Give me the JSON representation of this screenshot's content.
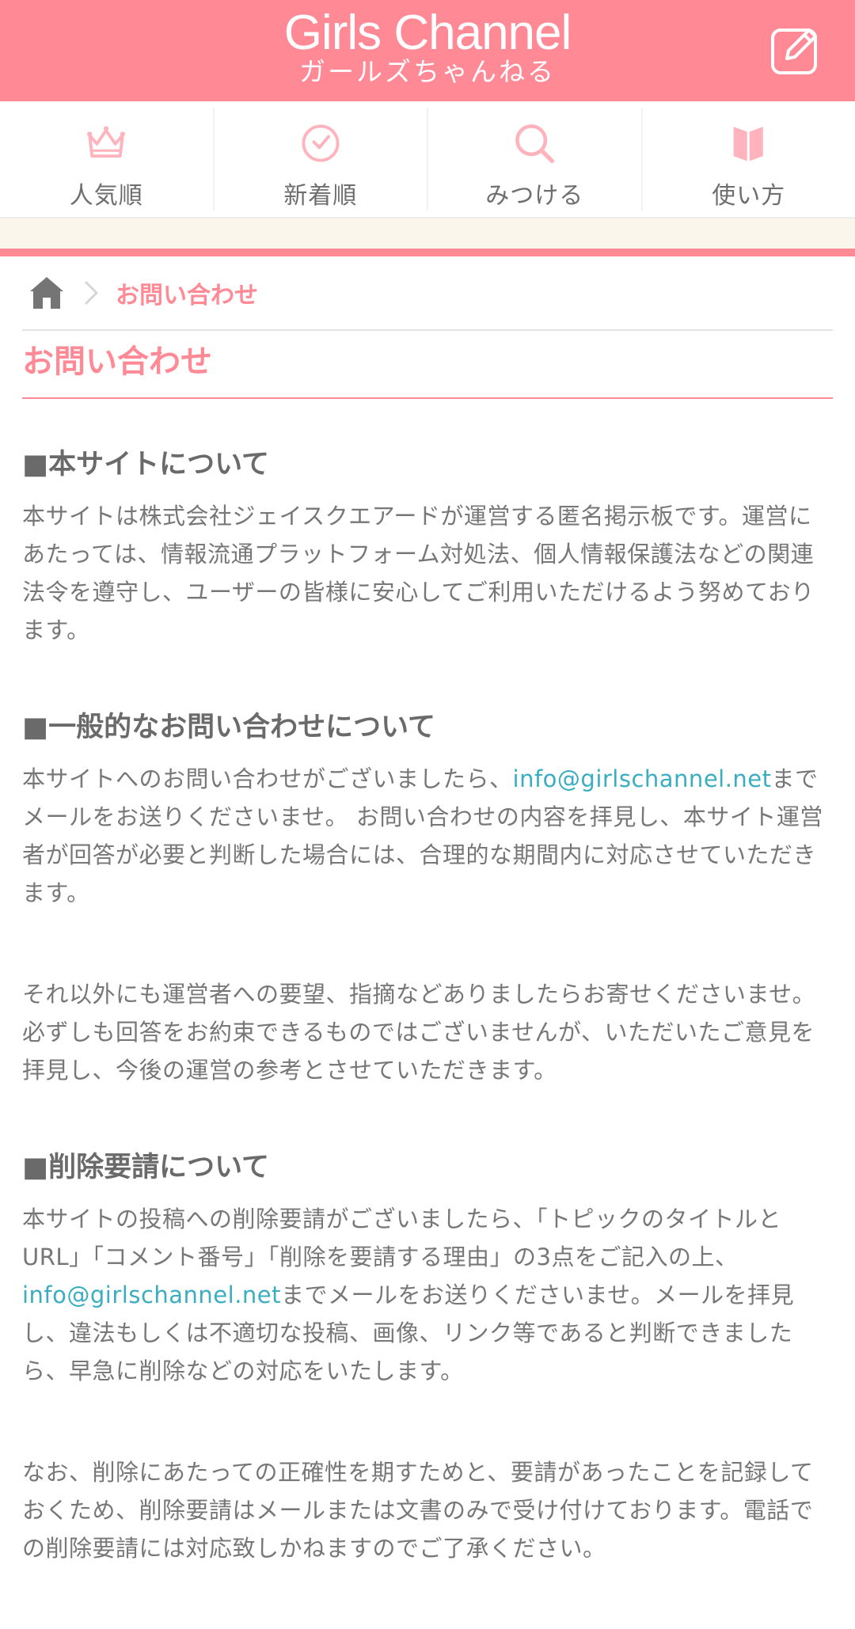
{
  "header": {
    "logo_en": "Girls Channel",
    "logo_ja": "ガールズちゃんねる",
    "bg_color": "#ff8a96",
    "post_icon": "edit-icon"
  },
  "nav": {
    "items": [
      {
        "label": "人気順",
        "icon": "crown-icon"
      },
      {
        "label": "新着順",
        "icon": "clock-icon"
      },
      {
        "label": "みつける",
        "icon": "search-icon"
      },
      {
        "label": "使い方",
        "icon": "book-icon"
      }
    ]
  },
  "breadcrumb": {
    "home_icon": "home-icon",
    "current": "お問い合わせ"
  },
  "page": {
    "title": "お問い合わせ"
  },
  "sections": {
    "about": {
      "title": "■本サイトについて",
      "body": "本サイトは株式会社ジェイスクエアードが運営する匿名掲示板です。運営にあたっては、情報流通プラットフォーム対処法、個人情報保護法などの関連法令を遵守し、ユーザーの皆様に安心してご利用いただけるよう努めております。"
    },
    "general": {
      "title": "■一般的なお問い合わせについて",
      "body1_pre": "本サイトへのお問い合わせがございましたら、",
      "email": "info@girlschannel.net",
      "body1_post": "までメールをお送りくださいませ。 お問い合わせの内容を拝見し、本サイト運営者が回答が必要と判断した場合には、合理的な期間内に対応させていただきます。",
      "body2": "それ以外にも運営者への要望、指摘などありましたらお寄せくださいませ。必ずしも回答をお約束できるものではございませんが、いただいたご意見を拝見し、今後の運営の参考とさせていただきます。"
    },
    "deletion": {
      "title": "■削除要請について",
      "body1_pre": "本サイトの投稿への削除要請がございましたら、「トピックのタイトルとURL」「コメント番号」「削除を要請する理由」の3点をご記入の上、",
      "email": "info@girlschannel.net",
      "body1_post": "までメールをお送りくださいませ。メールを拝見し、違法もしくは不適切な投稿、画像、リンク等であると判断できましたら、早急に削除などの対応をいたします。",
      "body2": "なお、削除にあたっての正確性を期すためと、要請があったことを記録しておくため、削除要請はメールまたは文書のみで受け付けております。電話での削除要請には対応致しかねますのでご了承ください。"
    }
  },
  "colors": {
    "accent": "#ff8a96",
    "link": "#3aaec0",
    "text": "#777777"
  }
}
